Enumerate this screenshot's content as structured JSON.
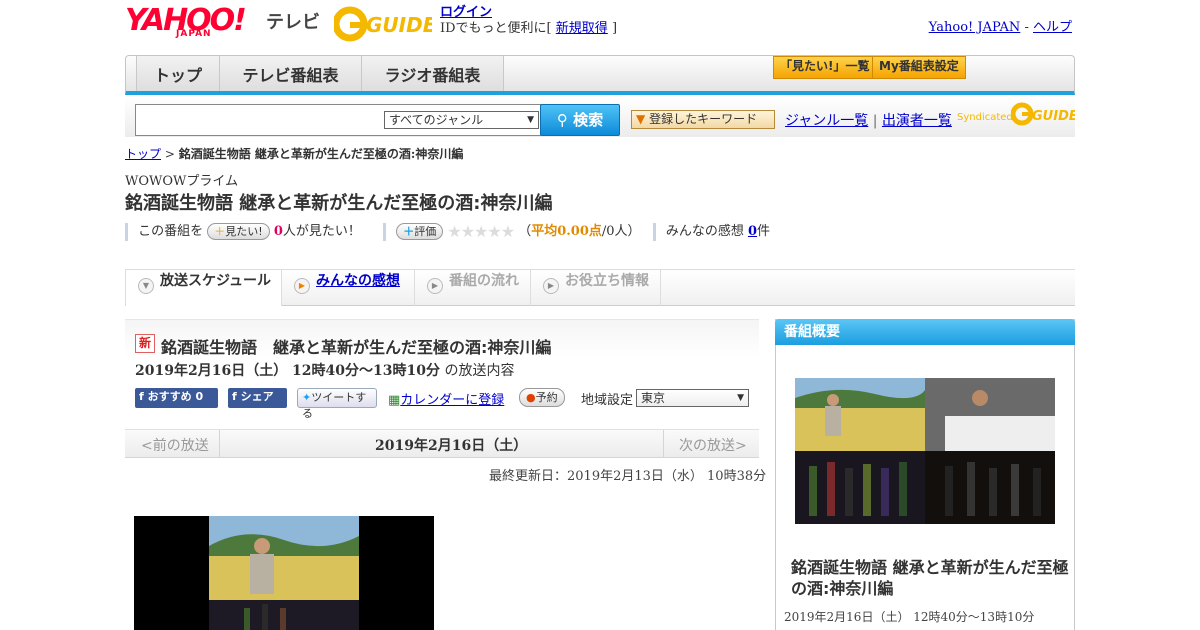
{
  "header": {
    "logo_text": "YAHOO!",
    "logo_sub": "JAPAN",
    "service": "テレビ",
    "gguide_logo": "G-GUIDE",
    "login": "ログイン",
    "login_desc": "IDでもっと便利に[",
    "signup": "新規取得",
    "login_desc_end": "]",
    "yahoo_japan_link": "Yahoo! JAPAN",
    "sep": "-",
    "help_link": "ヘルプ"
  },
  "nav": {
    "tabs": [
      "トップ",
      "テレビ番組表",
      "ラジオ番組表"
    ],
    "mitai_list": "「見たい!」一覧",
    "my_schedule": "My番組表設定"
  },
  "search": {
    "genre_selected": "すべてのジャンル",
    "button": "検索",
    "keyword_btn": "登録したキーワード",
    "genre_list": "ジャンル一覧",
    "pipe": "|",
    "performer_list": "出演者一覧",
    "syndicated": "Syndicated"
  },
  "breadcrumb": {
    "top": "トップ",
    "sep": ">",
    "current": "銘酒誕生物語 継承と革新が生んだ至極の酒:神奈川編"
  },
  "program": {
    "channel": "WOWOWプライム",
    "title": "銘酒誕生物語 継承と革新が生んだ至極の酒:神奈川編",
    "this_program": "この番組を",
    "mitai_btn": "見たい!",
    "mitai_count": "0",
    "mitai_suffix": "人が見たい！",
    "rate_btn": "評価",
    "stars": "★★★★★",
    "avg_open": "（",
    "avg_label": "平均0.00点",
    "avg_people": "/0人）",
    "impressions_label": "みんなの感想",
    "impressions_count": "0",
    "impressions_suffix": "件"
  },
  "tabs": [
    "放送スケジュール",
    "みんなの感想",
    "番組の流れ",
    "お役立ち情報"
  ],
  "broadcast": {
    "new_badge": "新",
    "title": "銘酒誕生物語　継承と革新が生んだ至極の酒:神奈川編",
    "datetime": "2019年2月16日（土）  12時40分～13時10分",
    "suffix": "の放送内容",
    "fb_recommend": "おすすめ 0",
    "fb_share": "シェア",
    "tweet": "ツイートする",
    "calendar": "カレンダーに登録",
    "reserve": "予約",
    "region_label": "地域設定",
    "region_selected": "東京"
  },
  "datenav": {
    "prev": "<前の放送",
    "current": "2019年2月16日（土）",
    "next": "次の放送>"
  },
  "updated": "最終更新日：2019年2月13日（水）  10時38分",
  "sidebar": {
    "heading": "番組概要",
    "title": "銘酒誕生物語 継承と革新が生んだ至極の酒:神奈川編",
    "time": "2019年2月16日（土）  12時40分～13時10分"
  }
}
